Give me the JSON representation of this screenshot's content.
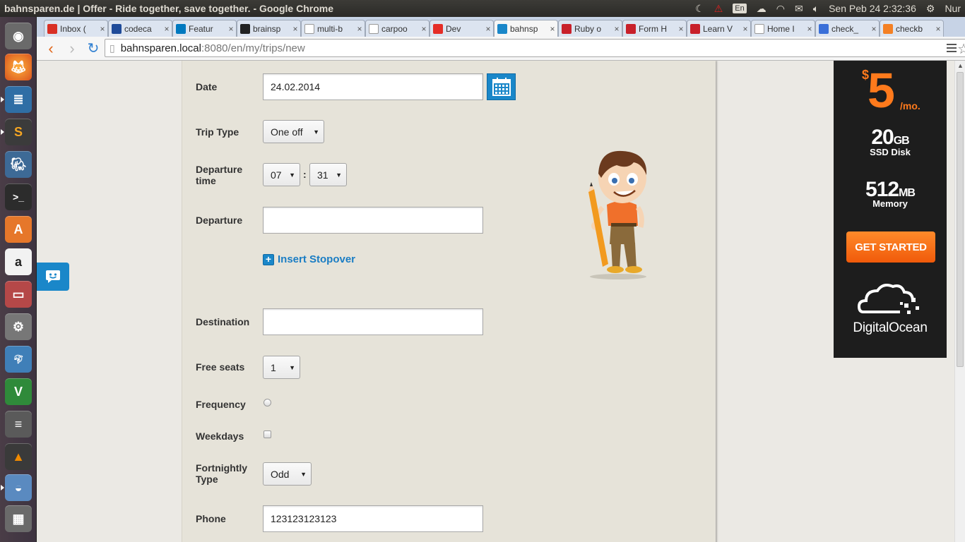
{
  "window_title": "bahnsparen.de | Offer - Ride together, save together. - Google Chrome",
  "indicators": {
    "lang": "En",
    "datetime": "Sen Peb 24   2:32:36",
    "user": "Nur"
  },
  "tabs": [
    {
      "label": "Inbox (",
      "fav": "gmail-icon"
    },
    {
      "label": "codeca",
      "fav": "codecademy-icon"
    },
    {
      "label": "Featur",
      "fav": "trello-icon"
    },
    {
      "label": "brainsp",
      "fav": "github-icon"
    },
    {
      "label": "multi-b",
      "fav": "document-icon"
    },
    {
      "label": "carpoo",
      "fav": "document-icon"
    },
    {
      "label": "Dev",
      "fav": "youtube-icon"
    },
    {
      "label": "bahnsp",
      "fav": "bahnsparen-icon"
    },
    {
      "label": "Ruby o",
      "fav": "ruby-icon"
    },
    {
      "label": "Form H",
      "fav": "ruby-icon"
    },
    {
      "label": "Learn V",
      "fav": "learn-icon"
    },
    {
      "label": "Home I",
      "fav": "document-icon"
    },
    {
      "label": "check_",
      "fav": "a-icon"
    },
    {
      "label": "checkb",
      "fav": "stack-icon"
    }
  ],
  "address": {
    "host": "bahnsparen.local",
    "rest": ":8080/en/my/trips/new"
  },
  "form": {
    "date_label": "Date",
    "date_value": "24.02.2014",
    "trip_type_label": "Trip Type",
    "trip_type_value": "One off",
    "departure_time_label_1": "Departure",
    "departure_time_label_2": "time",
    "hour_value": "07",
    "time_separator": ":",
    "minute_value": "31",
    "departure_label": "Departure",
    "departure_value": "",
    "insert_stopover": "Insert Stopover",
    "destination_label": "Destination",
    "destination_value": "",
    "free_seats_label": "Free seats",
    "free_seats_value": "1",
    "frequency_label": "Frequency",
    "weekdays_label": "Weekdays",
    "fortnightly_label_1": "Fortnightly",
    "fortnightly_label_2": "Type",
    "fortnightly_value": "Odd",
    "phone_label": "Phone",
    "phone_value": "123123123123"
  },
  "ad": {
    "currency": "$",
    "price": "5",
    "per": "/mo.",
    "disk_num": "20",
    "disk_unit": "GB",
    "disk_label": "SSD Disk",
    "mem_num": "512",
    "mem_unit": "MB",
    "mem_label": "Memory",
    "cta": "GET STARTED",
    "brand": "DigitalOcean"
  },
  "colors": {
    "accent": "#1a87c9",
    "ad_orange": "#ff7a1c"
  }
}
